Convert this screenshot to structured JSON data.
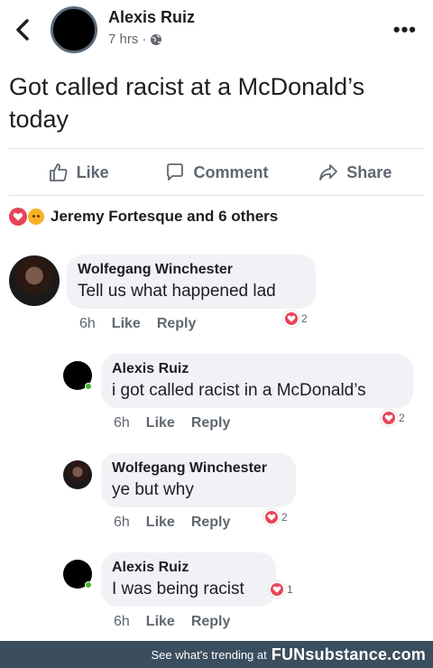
{
  "post": {
    "author": "Alexis Ruiz",
    "time": "7 hrs",
    "separator": "·",
    "text": "Got called racist at a McDonald’s today"
  },
  "actions": {
    "like": "Like",
    "comment": "Comment",
    "share": "Share"
  },
  "reactions": {
    "summary": "Jeremy Fortesque and 6 others"
  },
  "comments": [
    {
      "author": "Wolfegang Winchester",
      "text": "Tell us what happened lad",
      "time": "6h",
      "like": "Like",
      "reply": "Reply",
      "reaction_count": "2"
    },
    {
      "author": "Alexis Ruiz",
      "text": "i got called racist in a McDonald’s",
      "time": "6h",
      "like": "Like",
      "reply": "Reply",
      "reaction_count": "2"
    },
    {
      "author": "Wolfegang Winchester",
      "text": "ye but why",
      "time": "6h",
      "like": "Like",
      "reply": "Reply",
      "reaction_count": "2"
    },
    {
      "author": "Alexis Ruiz",
      "text": "I was being racist",
      "time": "6h",
      "like": "Like",
      "reply": "Reply",
      "reaction_count": "1"
    }
  ],
  "banner": {
    "text": "See what's trending at",
    "brand": "FUNsubstance.com"
  },
  "icons": {
    "back": "chevron-left-icon",
    "privacy": "globe-icon",
    "more": "more-horizontal-icon",
    "like": "thumbs-up-icon",
    "comment": "speech-bubble-icon",
    "share": "share-arrow-icon",
    "reaction": "heart-reaction-icon",
    "sad": "sad-reaction-icon"
  },
  "colors": {
    "reaction_heart": "#e84458",
    "reaction_sad": "#f7b125",
    "bubble_bg": "#f0f2f5",
    "secondary_text": "#606770",
    "banner_bg": "#3b4e5e",
    "online": "#42b72a"
  }
}
